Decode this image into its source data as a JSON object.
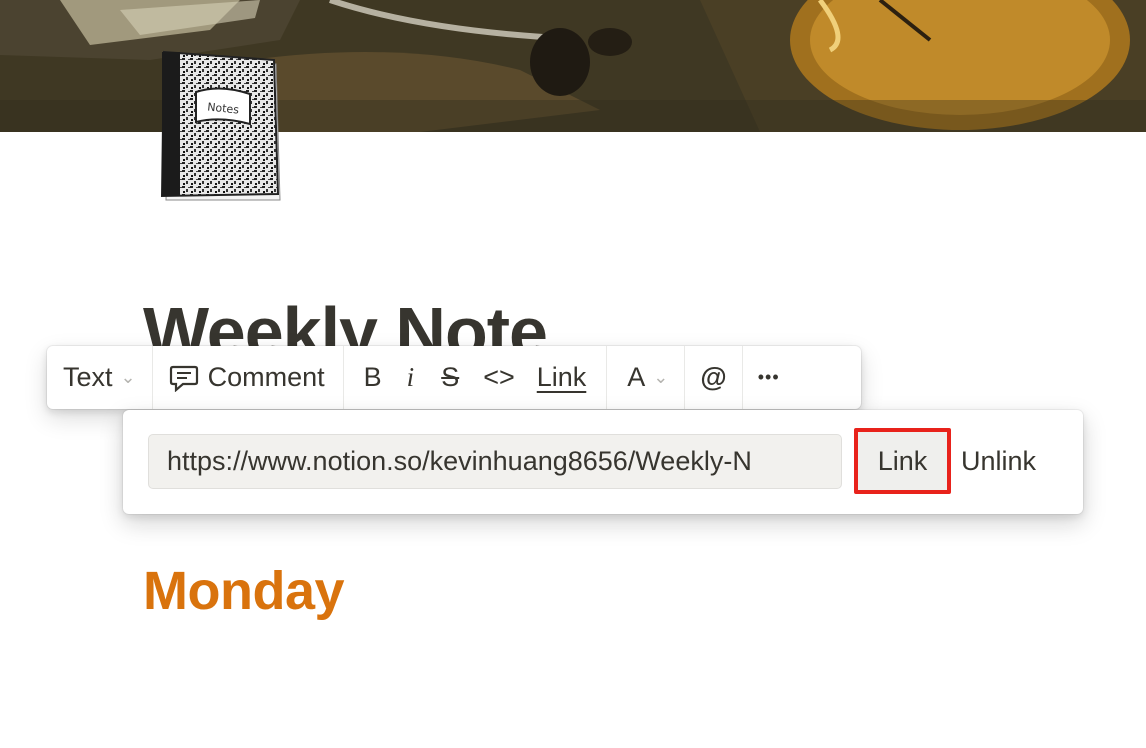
{
  "page": {
    "title": "Weekly Note",
    "icon": "notebook-icon",
    "icon_label": "Notes"
  },
  "toolbar": {
    "block_type": "Text",
    "comment_label": "Comment",
    "bold_label": "B",
    "italic_label": "i",
    "strike_label": "S",
    "code_label": "<>",
    "link_label": "Link",
    "color_label": "A",
    "mention_label": "@",
    "more_label": "•••"
  },
  "link_popover": {
    "url_value": "https://www.notion.so/kevinhuang8656/Weekly-N",
    "link_button": "Link",
    "unlink_button": "Unlink"
  },
  "content": {
    "heading": "Monday",
    "heading_color": "#d9730d"
  }
}
